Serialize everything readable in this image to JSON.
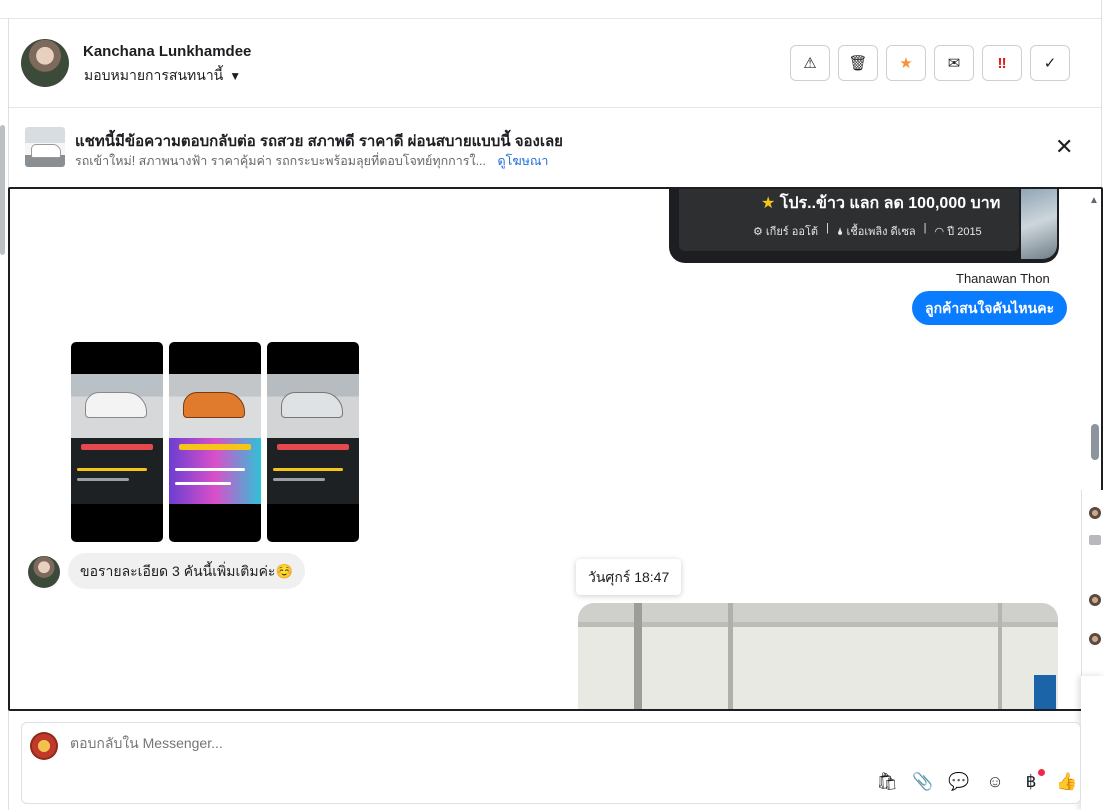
{
  "contact": {
    "name": "Kanchana Lunkhamdee",
    "assign_label": "มอบหมายการสนทนานี้"
  },
  "header_actions": [
    {
      "name": "report-spam-button",
      "icon": "warning-icon",
      "glyph": "⚠"
    },
    {
      "name": "delete-button",
      "icon": "trash-icon",
      "glyph": "🗑"
    },
    {
      "name": "follow-up-button",
      "icon": "star-icon",
      "glyph": "★"
    },
    {
      "name": "mark-unread-button",
      "icon": "envelope-icon",
      "glyph": "✉"
    },
    {
      "name": "priority-button",
      "icon": "double-exclamation-icon",
      "glyph": "‼"
    },
    {
      "name": "mark-done-button",
      "icon": "check-icon",
      "glyph": "✓"
    }
  ],
  "ad_banner": {
    "title": "แชทนี้มีข้อความตอบกลับต่อ รถสวย สภาพดี ราคาดี ผ่อนสบายแบบนี้ จองเลย",
    "subtitle": "รถเข้าใหม่! สภาพนางฟ้า ราคาคุ้มค่า รถกระบะพร้อมลุยที่ตอบโจทย์ทุกการใ...",
    "link": "ดูโฆษณา",
    "close": "✕"
  },
  "messages": {
    "card": {
      "promo_star": "★",
      "promo": "โปร..ข้าว แลก ลด 100,000 บาท",
      "specs": [
        "⚙ เกียร์ ออโต้",
        "|",
        "🌢 เชื้อเพลิง ดีเซล",
        "|",
        "◠ ปี 2015"
      ]
    },
    "sender": "Thanawan Thon",
    "outgoing_text": "ลูกค้าสนใจคันไหนคะ",
    "incoming_text": "ขอรายละเอียด 3 คันนี้เพิ่มเติมค่ะ☺️",
    "timestamp": "วันศุกร์ 18:47"
  },
  "composer": {
    "placeholder": "ตอบกลับใน Messenger..."
  },
  "composer_tools": [
    {
      "name": "shopping-bag-icon",
      "glyph": "🛍"
    },
    {
      "name": "attachment-icon",
      "glyph": "📎"
    },
    {
      "name": "saved-reply-icon",
      "glyph": "💬"
    },
    {
      "name": "emoji-icon",
      "glyph": "☺"
    },
    {
      "name": "baht-payment-icon",
      "glyph": "฿"
    },
    {
      "name": "thumbs-up-icon",
      "glyph": "👍"
    }
  ],
  "colors": {
    "accent": "#0a7cff",
    "link": "#216fdb",
    "star": "#f7923a",
    "urgent": "#d91e18"
  }
}
